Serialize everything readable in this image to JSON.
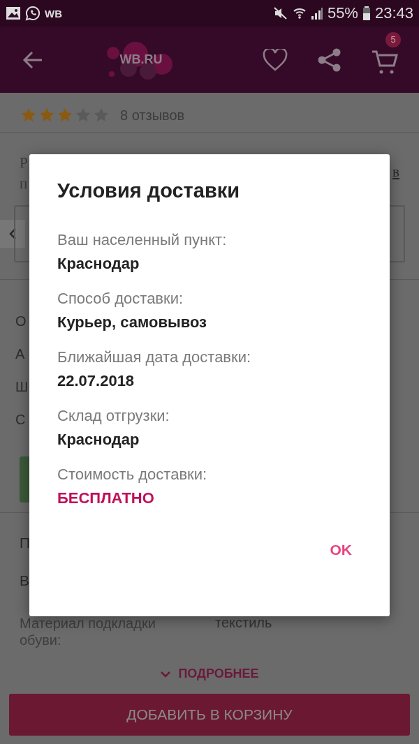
{
  "status_bar": {
    "app_label": "WB",
    "battery": "55%",
    "time": "23:43"
  },
  "header": {
    "logo": "WB.RU",
    "cart_count": "5"
  },
  "product": {
    "stars": 3,
    "reviews": "8 отзывов"
  },
  "section_1": {
    "line_1": "Р",
    "line_2": "п",
    "link": "в"
  },
  "rows_1": [
    "О",
    "А",
    "Ш",
    "С"
  ],
  "rows_2": [
    "П",
    "В"
  ],
  "spec": {
    "label": "Материал подкладки обуви:",
    "value": "текстиль"
  },
  "more_link": "ПОДРОБНЕЕ",
  "add_button": "ДОБАВИТЬ В КОРЗИНУ",
  "dialog": {
    "title": "Условия доставки",
    "fields": [
      {
        "label": "Ваш населенный пункт:",
        "value": "Краснодар",
        "kind": "plain"
      },
      {
        "label": "Способ доставки:",
        "value": "Курьер, самовывоз",
        "kind": "plain"
      },
      {
        "label": "Ближайшая дата доставки:",
        "value": "22.07.2018",
        "kind": "plain"
      },
      {
        "label": "Склад отгрузки:",
        "value": "Краснодар",
        "kind": "plain"
      },
      {
        "label": "Стоимость доставки:",
        "value": "БЕСПЛАТНО",
        "kind": "highlight"
      }
    ],
    "ok": "OK"
  }
}
